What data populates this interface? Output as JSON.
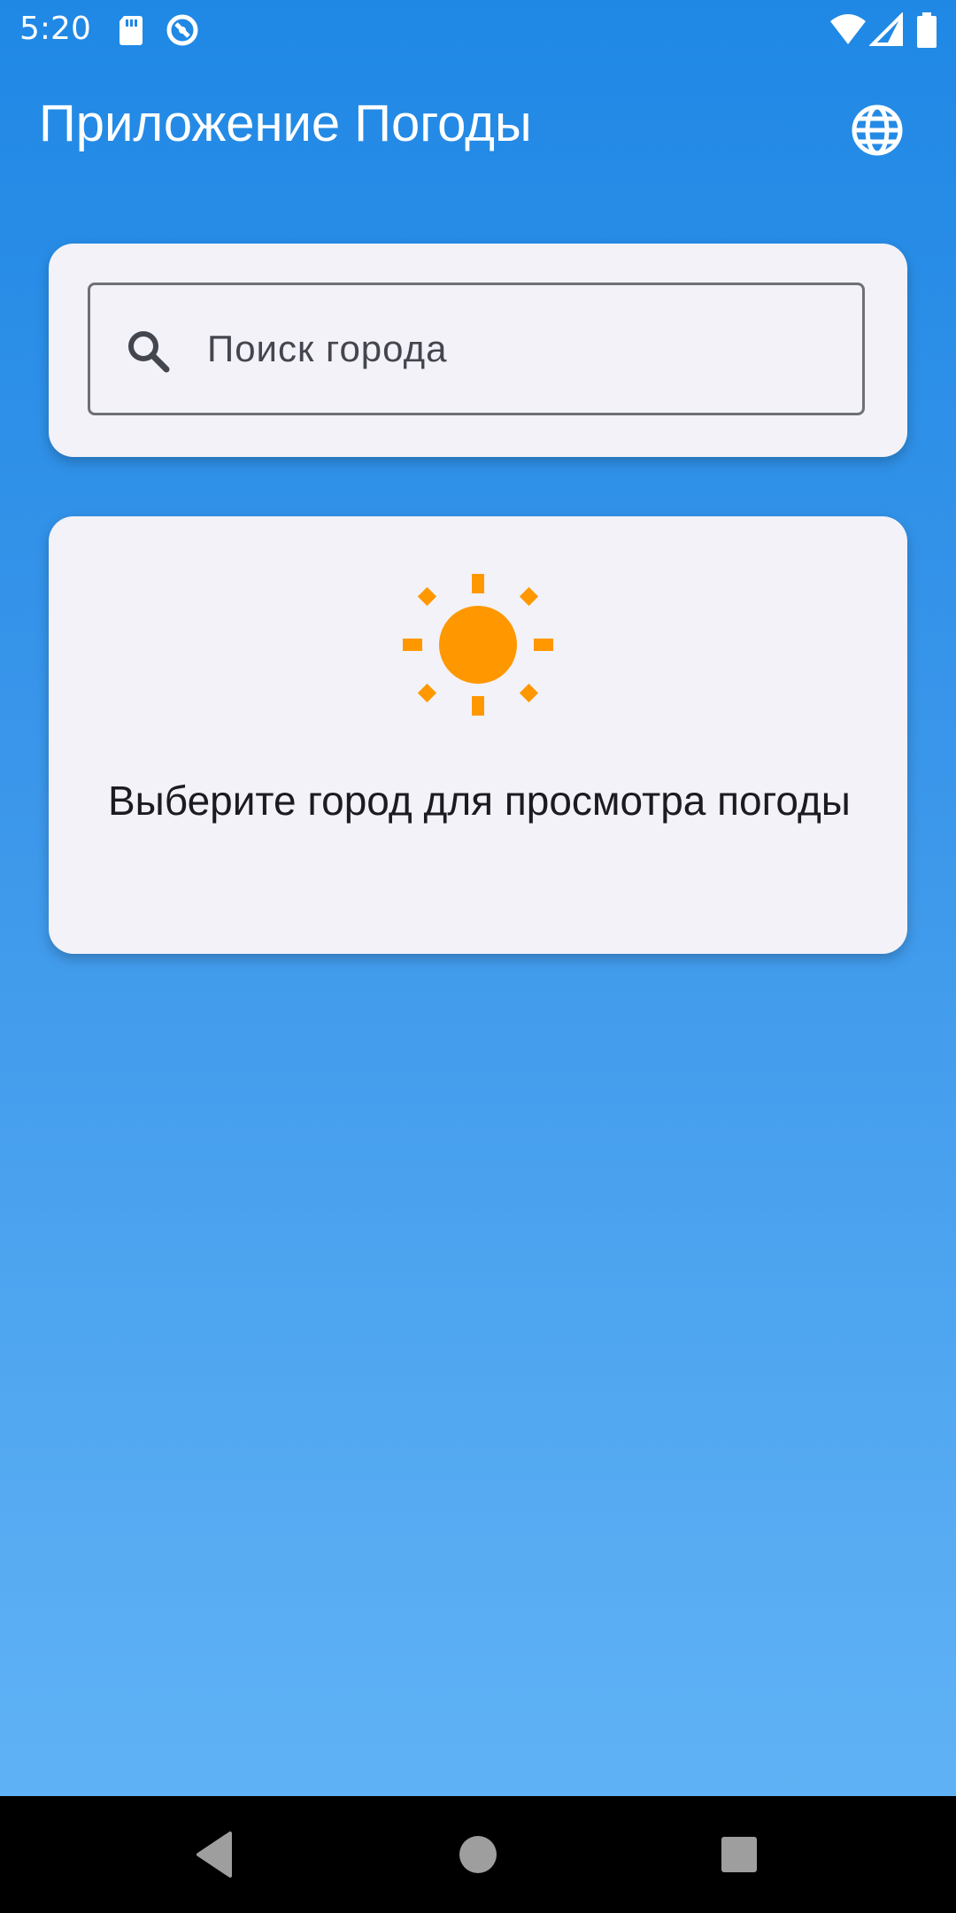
{
  "status_bar": {
    "time": "5:20",
    "left_icons": [
      "sd-card-icon",
      "data-saver-icon"
    ],
    "right_icons": [
      "wifi-icon",
      "cell-signal-icon",
      "battery-icon"
    ]
  },
  "app_bar": {
    "title": "Приложение Погоды",
    "action_icon": "globe-icon"
  },
  "search": {
    "placeholder": "Поиск города",
    "value": "",
    "icon": "search-icon"
  },
  "weather_card": {
    "icon": "sun-icon",
    "message": "Выберите город для просмотра погоды"
  },
  "nav_bar": {
    "buttons": [
      "back-icon",
      "home-icon",
      "recents-icon"
    ]
  },
  "colors": {
    "gradient_top": "#1f88e5",
    "gradient_bottom": "#63b4f6",
    "card_background": "#f2f2f8",
    "sun": "#ff9800",
    "nav_bar": "#000000"
  }
}
